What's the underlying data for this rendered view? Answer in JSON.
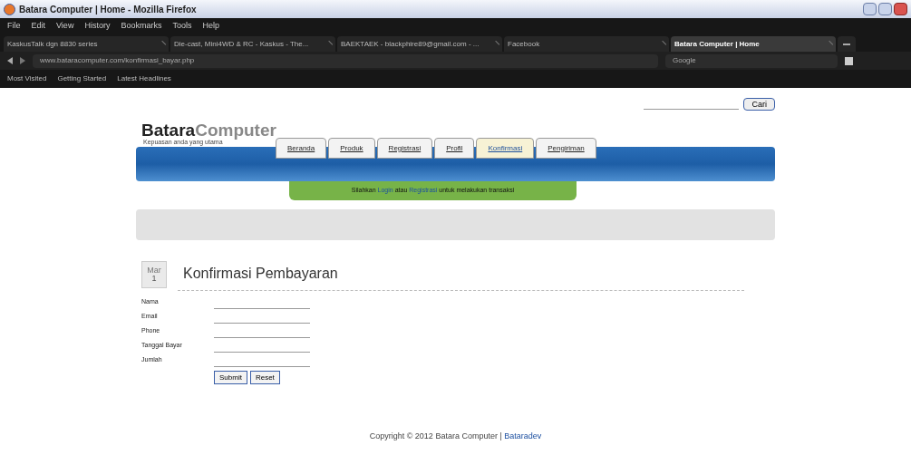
{
  "window": {
    "title": "Batara Computer | Home - Mozilla Firefox"
  },
  "menu": [
    "File",
    "Edit",
    "View",
    "History",
    "Bookmarks",
    "Tools",
    "Help"
  ],
  "browser_tabs": [
    {
      "label": "KaskusTalk dgn 8830 series",
      "selected": false
    },
    {
      "label": "Die-cast, Mini4WD & RC - Kaskus - The...",
      "selected": false
    },
    {
      "label": "BAEKTAEK - blackphire89@gmail.com - ...",
      "selected": false
    },
    {
      "label": "Facebook",
      "selected": false
    },
    {
      "label": "Batara Computer | Home",
      "selected": true
    }
  ],
  "address": "www.bataracomputer.com/konfirmasi_bayar.php",
  "search_engine": "Google",
  "bookmarks": [
    "Most Visited",
    "Getting Started",
    "Latest Headlines"
  ],
  "page": {
    "search_button": "Cari",
    "logo": {
      "bold": "Batara",
      "light": "Computer"
    },
    "tagline": "Kepuasan anda yang utama",
    "nav": [
      {
        "label": "Beranda",
        "selected": false
      },
      {
        "label": "Produk",
        "selected": false
      },
      {
        "label": "Registrasi",
        "selected": false
      },
      {
        "label": "Profil",
        "selected": false
      },
      {
        "label": "Konfirmasi",
        "selected": true
      },
      {
        "label": "Pengiriman",
        "selected": false
      }
    ],
    "notice": {
      "before": "Silahkan",
      "link1": "Login",
      "middle": "atau",
      "link2": "Registrasi",
      "after": "untuk melakukan transaksi"
    },
    "date": {
      "month": "Mar",
      "day": "1"
    },
    "heading": "Konfirmasi Pembayaran",
    "fields": [
      "Nama",
      "Email",
      "Phone",
      "Tanggal Bayar",
      "Jumlah"
    ],
    "buttons": [
      "Submit",
      "Reset"
    ],
    "footer": {
      "text": "Copyright © 2012 Batara Computer |",
      "link": "Bataradev"
    }
  }
}
